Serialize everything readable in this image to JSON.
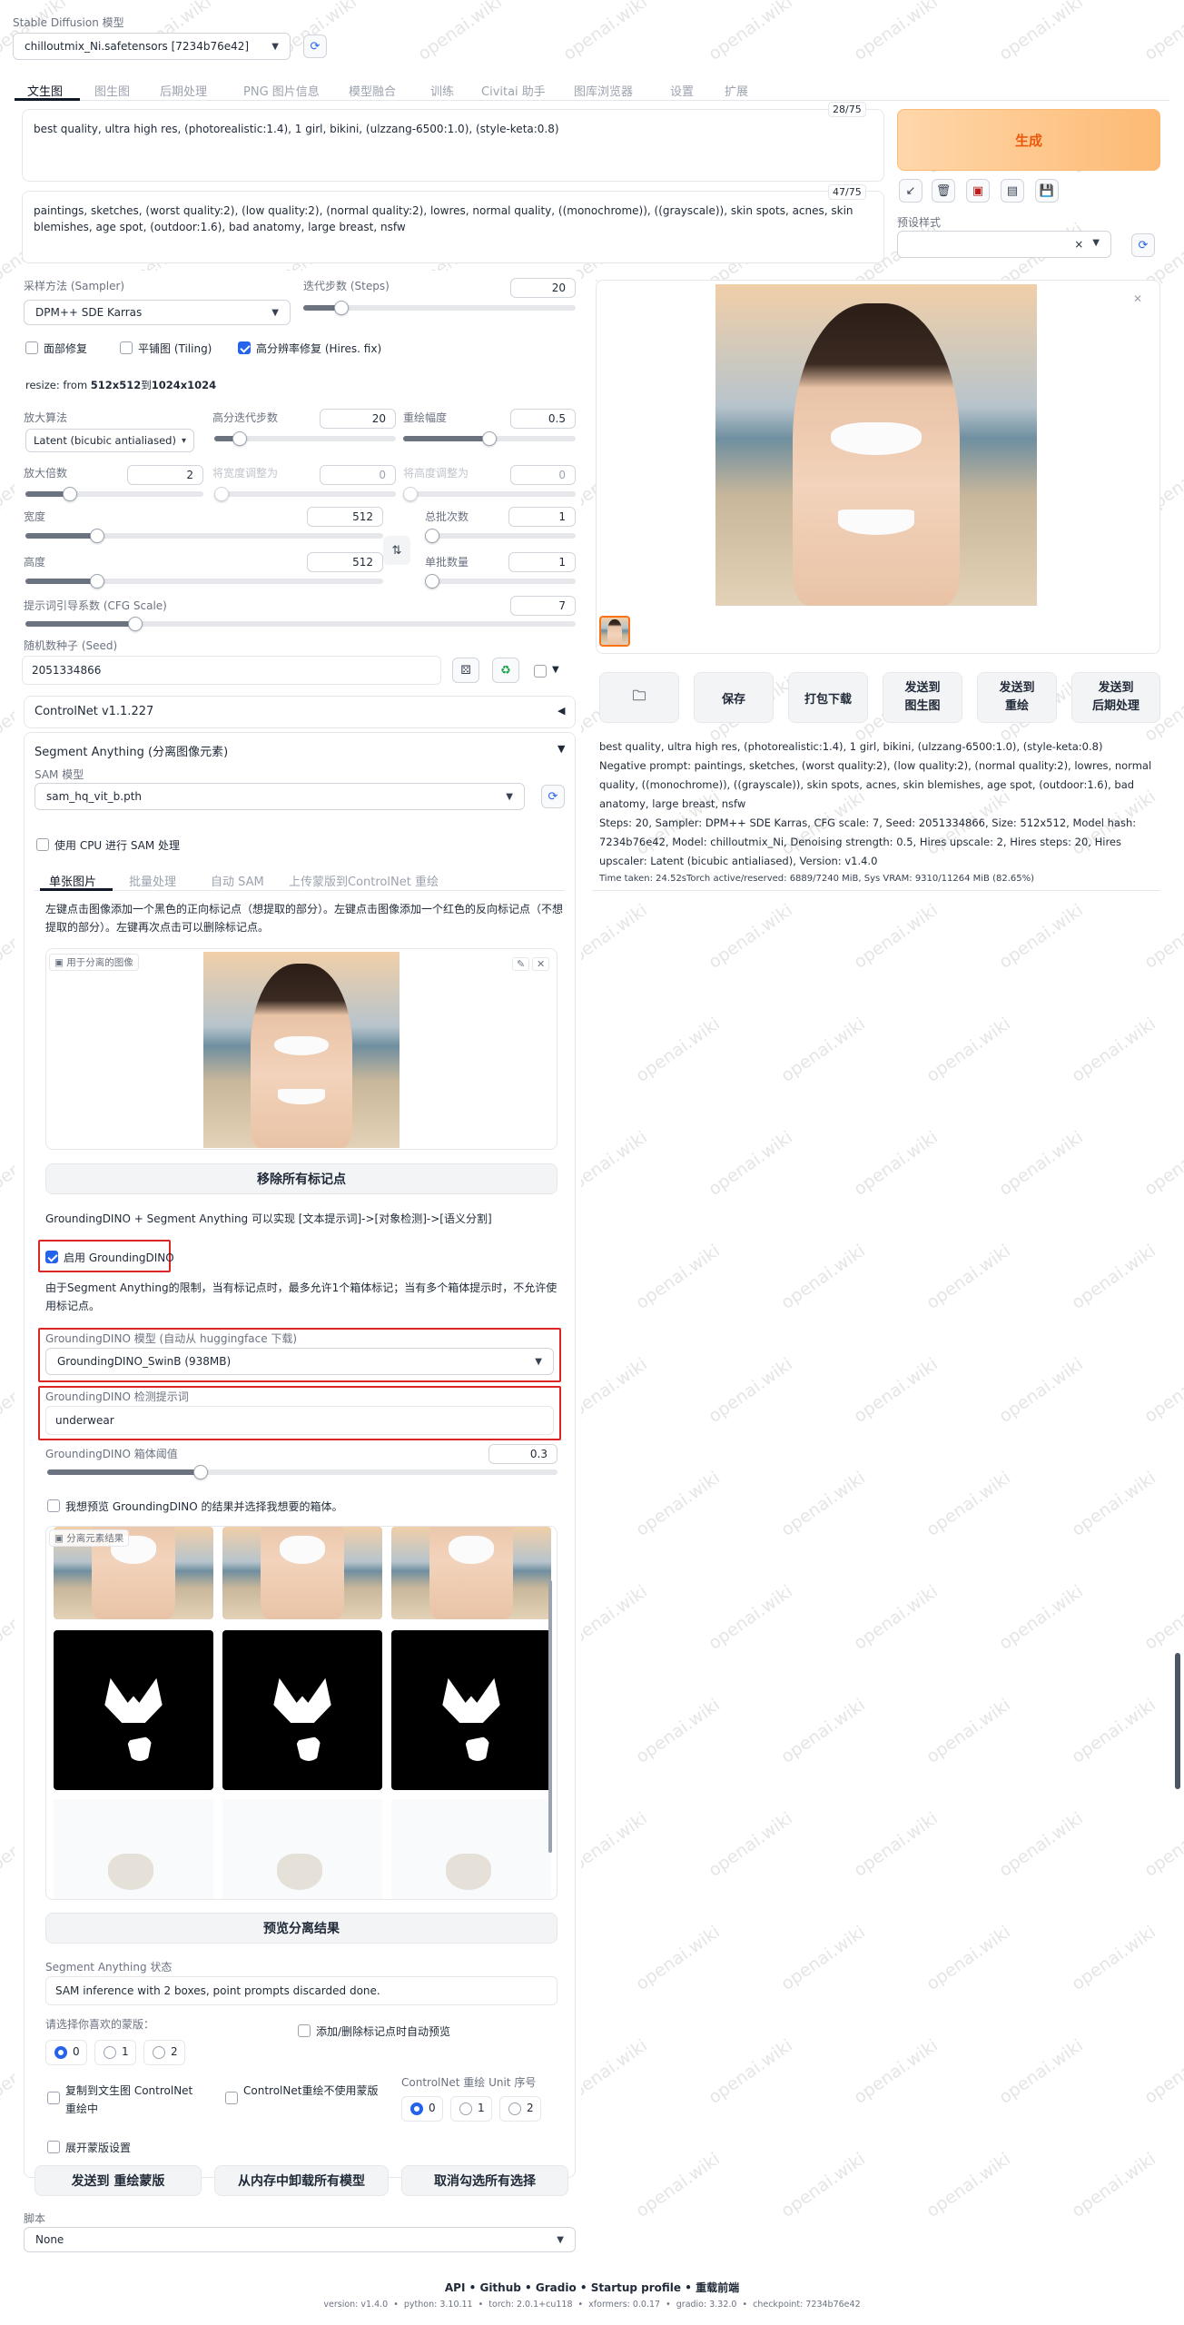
{
  "model": {
    "label": "Stable Diffusion 模型",
    "value": "chilloutmix_Ni.safetensors [7234b76e42]"
  },
  "tabs": [
    {
      "label": "文生图",
      "active": true
    },
    {
      "label": "图生图"
    },
    {
      "label": "后期处理"
    },
    {
      "label": "PNG 图片信息"
    },
    {
      "label": "模型融合"
    },
    {
      "label": "训练"
    },
    {
      "label": "Civitai 助手"
    },
    {
      "label": "图库浏览器"
    },
    {
      "label": "设置"
    },
    {
      "label": "扩展"
    }
  ],
  "prompt": {
    "text": "best quality, ultra high res, (photorealistic:1.4), 1 girl, bikini, (ulzzang-6500:1.0), (style-keta:0.8)",
    "counter": "28/75"
  },
  "negative": {
    "text": "paintings, sketches, (worst quality:2), (low quality:2), (normal quality:2), lowres, normal quality, ((monochrome)), ((grayscale)), skin spots, acnes, skin blemishes, age spot, (outdoor:1.6), bad anatomy, large breast, nsfw",
    "counter": "47/75"
  },
  "generate_label": "生成",
  "style": {
    "label": "预设样式",
    "close": "×"
  },
  "sampler": {
    "label": "采样方法 (Sampler)",
    "value": "DPM++ SDE Karras"
  },
  "steps": {
    "label": "迭代步数 (Steps)",
    "value": "20",
    "fraction": 0.14
  },
  "checks": {
    "face": "面部修复",
    "tiling": "平铺图 (Tiling)",
    "hires": "高分辨率修复 (Hires. fix)"
  },
  "resize": {
    "prefix": "resize: from ",
    "from": "512x512",
    "to_word": "到",
    "to": "1024x1024"
  },
  "upscaler": {
    "label": "放大算法",
    "value": "Latent (bicubic antialiased)"
  },
  "hires_steps": {
    "label": "高分迭代步数",
    "value": "20",
    "fraction": 0.14
  },
  "denoise": {
    "label": "重绘幅度",
    "value": "0.5",
    "fraction": 0.5
  },
  "upscale_by": {
    "label": "放大倍数",
    "value": "2",
    "fraction": 0.25
  },
  "resize_w": {
    "label": "将宽度调整为",
    "value": "0",
    "fraction": 0
  },
  "resize_h": {
    "label": "将高度调整为",
    "value": "0",
    "fraction": 0
  },
  "width": {
    "label": "宽度",
    "value": "512",
    "fraction": 0.2
  },
  "height": {
    "label": "高度",
    "value": "512",
    "fraction": 0.2
  },
  "batch_count": {
    "label": "总批次数",
    "value": "1",
    "fraction": 0
  },
  "batch_size": {
    "label": "单批数量",
    "value": "1",
    "fraction": 0
  },
  "cfg": {
    "label": "提示词引导系数 (CFG Scale)",
    "value": "7",
    "fraction": 0.2
  },
  "seed": {
    "label": "随机数种子 (Seed)",
    "value": "2051334866"
  },
  "controlnet_header": "ControlNet v1.1.227",
  "sam": {
    "header": "Segment Anything (分离图像元素)",
    "model_label": "SAM 模型",
    "model_value": "sam_hq_vit_b.pth",
    "cpu_label": "使用 CPU 进行 SAM 处理",
    "subtabs": [
      "单张图片",
      "批量处理",
      "自动 SAM",
      "上传蒙版到ControlNet 重绘"
    ],
    "instructions": "左键点击图像添加一个黑色的正向标记点（想提取的部分）。左键点击图像添加一个红色的反向标记点（不想提取的部分）。左键再次点击可以删除标记点。",
    "image_label": "用于分离的图像",
    "remove_points": "移除所有标记点",
    "gdino_desc": "GroundingDINO + Segment Anything 可以实现 [文本提示词]->[对象检测]->[语义分割]",
    "gdino_enable": "启用 GroundingDINO",
    "gdino_note": "由于Segment Anything的限制，当有标记点时，最多允许1个箱体标记；当有多个箱体提示时，不允许使用标记点。",
    "gdino_model_label": "GroundingDINO 模型 (自动从 huggingface 下载)",
    "gdino_model_value": "GroundingDINO_SwinB (938MB)",
    "gdino_prompt_label": "GroundingDINO 检测提示词",
    "gdino_prompt_value": "underwear",
    "box_threshold_label": "GroundingDINO 箱体阈值",
    "box_threshold_value": "0.3",
    "box_threshold_fraction": 0.3,
    "preview_check": "我想预览 GroundingDINO 的结果并选择我想要的箱体。",
    "gallery_label": "分离元素结果",
    "preview_btn": "预览分离结果",
    "status_label": "Segment Anything 状态",
    "status_value": "SAM inference with 2 boxes, point prompts discarded done.",
    "mask_choice_label": "请选择你喜欢的蒙版：",
    "mask_choices": [
      "0",
      "1",
      "2"
    ],
    "auto_preview": "添加/删除标记点时自动预览",
    "copy_cn": "复制到文生图 ControlNet 重绘中",
    "cn_no_mask": "ControlNet重绘不使用蒙版",
    "cn_unit_label": "ControlNet 重绘 Unit 序号",
    "cn_units": [
      "0",
      "1",
      "2"
    ],
    "expand_mask": "展开蒙版设置",
    "btn_send": "发送到 重绘蒙版",
    "btn_unload": "从内存中卸载所有模型",
    "btn_uncheck": "取消勾选所有选择"
  },
  "script": {
    "label": "脚本",
    "value": "None"
  },
  "actions": [
    "保存",
    "打包下载",
    "发送到\n图生图",
    "发送到\n重绘",
    "发送到\n后期处理"
  ],
  "info": {
    "line1": "best quality, ultra high res, (photorealistic:1.4), 1 girl, bikini, (ulzzang-6500:1.0), (style-keta:0.8)",
    "line2": "Negative prompt: paintings, sketches, (worst quality:2), (low quality:2), (normal quality:2), lowres, normal quality, ((monochrome)), ((grayscale)), skin spots, acnes, skin blemishes, age spot, (outdoor:1.6), bad anatomy, large breast, nsfw",
    "line3": "Steps: 20, Sampler: DPM++ SDE Karras, CFG scale: 7, Seed: 2051334866, Size: 512x512, Model hash: 7234b76e42, Model: chilloutmix_Ni, Denoising strength: 0.5, Hires upscale: 2, Hires steps: 20, Hires upscaler: Latent (bicubic antialiased), Version: v1.4.0",
    "time": "Time taken: 24.52sTorch active/reserved: 6889/7240 MiB, Sys VRAM: 9310/11264 MiB (82.65%)"
  },
  "footer": {
    "links": [
      "API",
      "Github",
      "Gradio",
      "Startup profile",
      "重载前端"
    ],
    "version": "version: v1.4.0  •  python: 3.10.11  •  torch: 2.0.1+cu118  •  xformers: 0.0.17  •  gradio: 3.32.0  •  checkpoint: 7234b76e42"
  },
  "watermark": "openai.wiki",
  "colors": {
    "accent": "#2563eb",
    "generate": "#fb923c",
    "highlight": "#dc2626"
  }
}
